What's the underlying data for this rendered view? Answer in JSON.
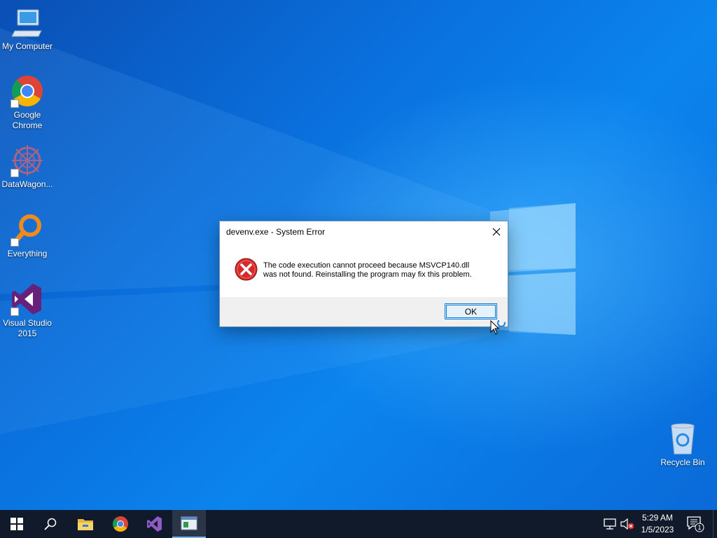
{
  "desktop": {
    "icons": [
      {
        "label": "My Computer",
        "icon": "computer-icon"
      },
      {
        "label": "Google\nChrome",
        "icon": "chrome-icon"
      },
      {
        "label": "DataWagon...",
        "icon": "datawagon-icon"
      },
      {
        "label": "Everything",
        "icon": "everything-search-icon"
      },
      {
        "label": "Visual Studio\n2015",
        "icon": "visual-studio-icon"
      },
      {
        "label": "Recycle Bin",
        "icon": "recycle-bin-icon"
      }
    ]
  },
  "dialog": {
    "title": "devenv.exe - System Error",
    "message_line1": "The code execution cannot proceed because MSVCP140.dll",
    "message_line2": "was not found. Reinstalling the program may fix this problem.",
    "ok_label": "OK",
    "icon": "error-icon"
  },
  "taskbar": {
    "buttons": [
      "start-icon",
      "search-icon",
      "file-explorer-icon",
      "chrome-icon",
      "visual-studio-icon",
      "app-window-icon"
    ],
    "clock_time": "5:29 AM",
    "clock_date": "1/5/2023",
    "notification_count": "1"
  },
  "colors": {
    "desktop_blue": "#0a6bd6",
    "taskbar": "#101a2a",
    "error_red": "#d42a2a",
    "accent": "#0078d7"
  }
}
